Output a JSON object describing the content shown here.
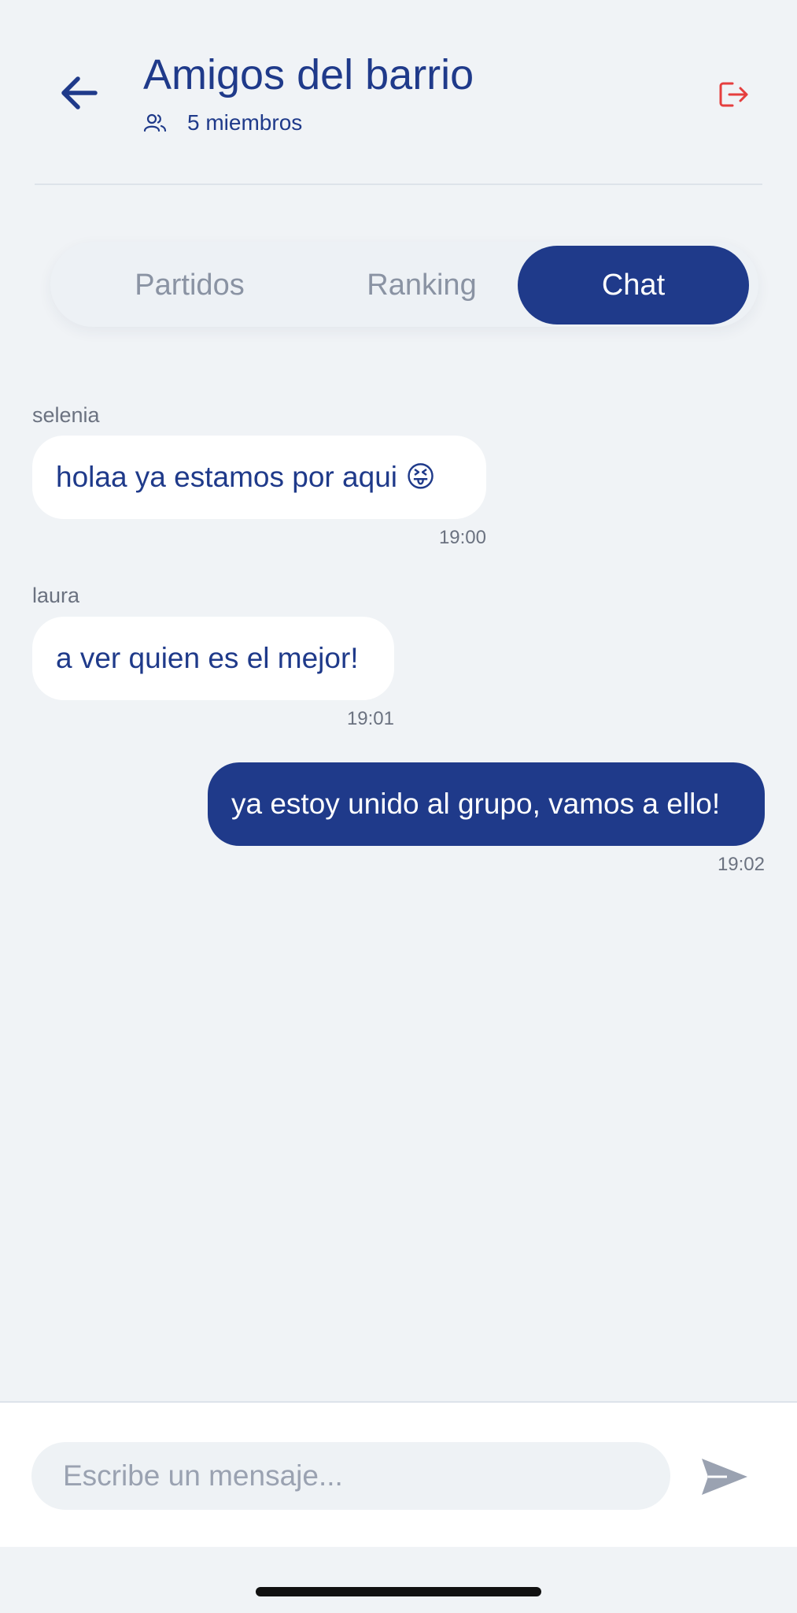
{
  "header": {
    "title": "Amigos del barrio",
    "members_label": "5 miembros",
    "back_icon": "arrow-left-icon",
    "members_icon": "users-icon",
    "leave_icon": "logout-icon"
  },
  "tabs": [
    {
      "label": "Partidos",
      "active": false
    },
    {
      "label": "Ranking",
      "active": false
    },
    {
      "label": "Chat",
      "active": true
    }
  ],
  "messages": [
    {
      "sender": "selenia",
      "text": "holaa ya estamos por aqui 😝",
      "time": "19:00",
      "direction": "incoming"
    },
    {
      "sender": "laura",
      "text": "a ver quien es el mejor!",
      "time": "19:01",
      "direction": "incoming"
    },
    {
      "sender": "",
      "text": "ya estoy unido al grupo, vamos a ello!",
      "time": "19:02",
      "direction": "outgoing"
    }
  ],
  "composer": {
    "placeholder": "Escribe un mensaje...",
    "value": "",
    "send_icon": "send-icon"
  },
  "colors": {
    "primary": "#1f3a8a",
    "background": "#f0f3f6",
    "leave": "#e53e3e",
    "muted": "#6b7280"
  }
}
